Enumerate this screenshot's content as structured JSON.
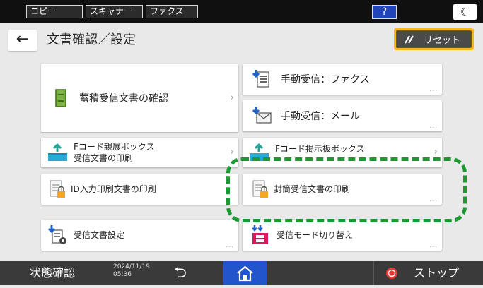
{
  "topbar": {
    "tabs": [
      {
        "label": "コピー"
      },
      {
        "label": "スキャナー"
      },
      {
        "label": "ファクス"
      }
    ],
    "help_label": "?",
    "night_icon": "moon-icon"
  },
  "header": {
    "back_icon": "arrow-left-icon",
    "title": "文書確認／設定",
    "reset_label": "リセット"
  },
  "cards": {
    "stored_docs": {
      "label": "蓄積受信文書の確認"
    },
    "manual_fax": {
      "label": "手動受信：ファクス"
    },
    "manual_mail": {
      "label": "手動受信：メール"
    },
    "fcode_personal": {
      "line1": "Fコード親展ボックス",
      "line2": "受信文書の印刷"
    },
    "fcode_bulletin": {
      "label": "Fコード掲示板ボックス"
    },
    "id_print": {
      "label": "ID入力印刷文書の印刷"
    },
    "envelope_print": {
      "label": "封筒受信文書の印刷"
    },
    "recv_settings": {
      "label": "受信文書設定"
    },
    "recv_mode": {
      "label": "受信モード切り替え"
    }
  },
  "highlight_color": "#1c9a32",
  "accent_color": "#fbb715",
  "bottombar": {
    "status_label": "状態確認",
    "date": "2024/11/19",
    "time": "05:36",
    "stop_label": "ストップ"
  }
}
